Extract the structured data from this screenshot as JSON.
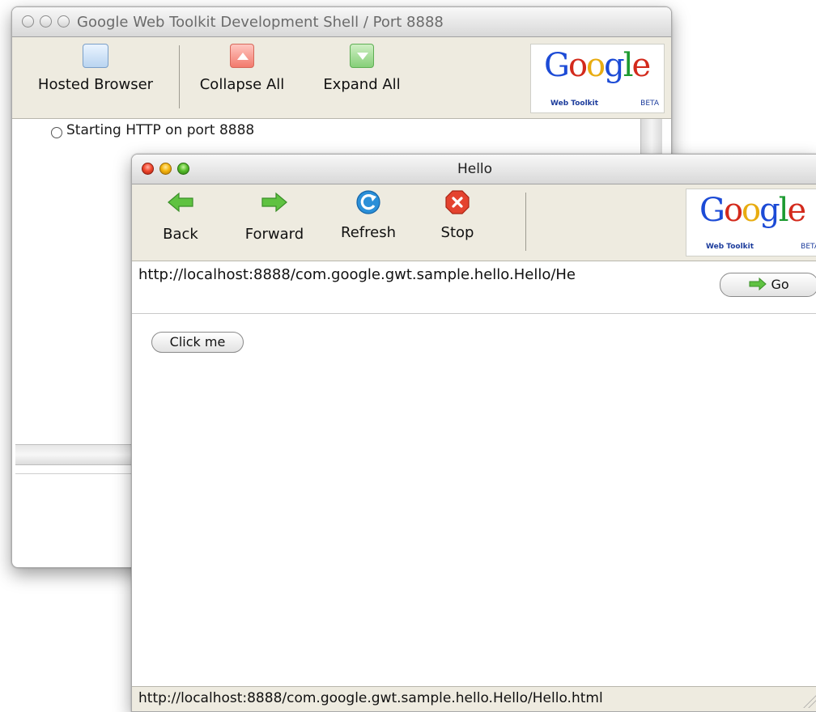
{
  "shell": {
    "title": "Google Web Toolkit Development Shell / Port 8888",
    "toolbar": {
      "hosted_browser": "Hosted Browser",
      "collapse_all": "Collapse All",
      "expand_all": "Expand All"
    },
    "log": [
      {
        "text": "Starting HTTP on port 8888",
        "icon": "radio-icon"
      }
    ],
    "logo": {
      "word": "Google",
      "sub": "Web Toolkit",
      "badge": "BETA"
    }
  },
  "browser": {
    "title": "Hello",
    "toolbar": {
      "back": "Back",
      "forward": "Forward",
      "refresh": "Refresh",
      "stop": "Stop"
    },
    "logo": {
      "word": "Google",
      "sub": "Web Toolkit",
      "badge": "BETA"
    },
    "url": "http://localhost:8888/com.google.gwt.sample.hello.Hello/He",
    "go_label": "Go",
    "page": {
      "button_label": "Click me"
    },
    "status": "http://localhost:8888/com.google.gwt.sample.hello.Hello/Hello.html"
  },
  "colors": {
    "toolbar_bg": "#eeebe0",
    "arrow_green": "#5fc241",
    "refresh_blue": "#2a8fd8",
    "stop_red": "#e4432f",
    "google_blue": "#1c4bd6",
    "google_red": "#d32a1c",
    "google_yellow": "#e8ac10",
    "google_green": "#1c9a30"
  }
}
